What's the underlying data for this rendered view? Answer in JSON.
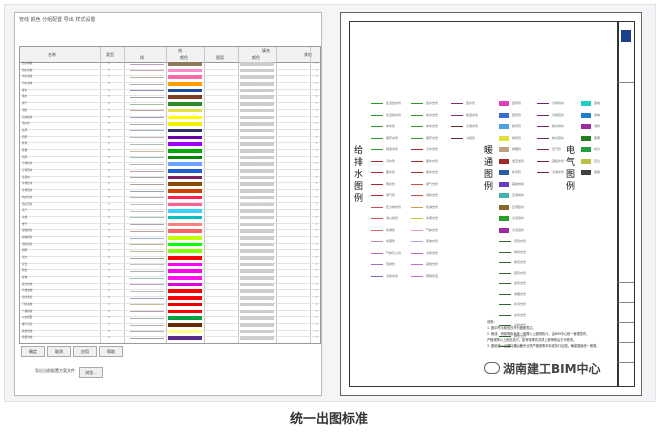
{
  "caption": "统一出图标准",
  "watermark": "湖南建工BIM中心",
  "dialog": {
    "title": "管线 颜色 分组配置 导出 样式设置",
    "headers": {
      "name": "名称",
      "type": "类型",
      "line_group": "线",
      "line_col": "线",
      "color_col": "颜色",
      "fill_group": "填充",
      "pattern_col": "图案",
      "fill_color_col": "颜色",
      "other_col": "其他"
    },
    "rows": [
      {
        "name": "给水系统",
        "num": "3",
        "line": "#b8a0c8",
        "color": "#8c7a5a"
      },
      {
        "name": "热水系统",
        "num": "3",
        "line": "#c8a0c0",
        "color": "#ff88cc"
      },
      {
        "name": "中水系统",
        "num": "3",
        "line": "#c0b0a0",
        "color": "#ff6aa8"
      },
      {
        "name": "污水系统",
        "num": "3",
        "line": "#b0b0b0",
        "color": "#ff9a00"
      },
      {
        "name": "废水",
        "num": "3",
        "line": "#9090c0",
        "color": "#1a4aa0"
      },
      {
        "name": "雨水",
        "num": "3",
        "line": "#a0a0a0",
        "color": "#7f3f1f"
      },
      {
        "name": "通气",
        "num": "3",
        "line": "#a0c0a0",
        "color": "#2a8a2a"
      },
      {
        "name": "消防",
        "num": "3",
        "line": "#c0a0a0",
        "color": "#e0e040"
      },
      {
        "name": "自动喷淋",
        "num": "3",
        "line": "#a0a0c0",
        "color": "#ffff00"
      },
      {
        "name": "消火栓",
        "num": "3",
        "line": "#b0a0b0",
        "color": "#f0f000"
      },
      {
        "name": "送风",
        "num": "3",
        "line": "#a0b0c0",
        "color": "#30306a"
      },
      {
        "name": "回风",
        "num": "3",
        "line": "#c0b0b0",
        "color": "#6a00aa"
      },
      {
        "name": "排风",
        "num": "3",
        "line": "#b0c0b0",
        "color": "#a000ff"
      },
      {
        "name": "排烟",
        "num": "3",
        "line": "#c0c0a0",
        "color": "#00aa00"
      },
      {
        "name": "新风",
        "num": "3",
        "line": "#a0c0c0",
        "color": "#008800"
      },
      {
        "name": "空调供水",
        "num": "3",
        "line": "#b0b0c0",
        "color": "#6aa0ff"
      },
      {
        "name": "空调回水",
        "num": "3",
        "line": "#c0a0b0",
        "color": "#2060d0"
      },
      {
        "name": "冷凝水",
        "num": "3",
        "line": "#a0b0a0",
        "color": "#7a2060"
      },
      {
        "name": "冷却供水",
        "num": "3",
        "line": "#b0a0a0",
        "color": "#8a4a00"
      },
      {
        "name": "冷却回水",
        "num": "3",
        "line": "#a0a0b0",
        "color": "#d04000"
      },
      {
        "name": "热水供水",
        "num": "3",
        "line": "#c0b0c0",
        "color": "#ff2050"
      },
      {
        "name": "热水回水",
        "num": "3",
        "line": "#b0c0c0",
        "color": "#ff6090"
      },
      {
        "name": "蒸汽",
        "num": "3",
        "line": "#c0c0b0",
        "color": "#3ad0ff"
      },
      {
        "name": "冷媒",
        "num": "3",
        "line": "#a0c0b0",
        "color": "#00c0c0"
      },
      {
        "name": "燃气",
        "num": "3",
        "line": "#b0a0c0",
        "color": "#ff8080"
      },
      {
        "name": "强电桥架",
        "num": "3",
        "line": "#c0a0a0",
        "color": "#ff6060"
      },
      {
        "name": "弱电桥架",
        "num": "3",
        "line": "#a0b0c0",
        "color": "#c0ff00"
      },
      {
        "name": "消防桥架",
        "num": "3",
        "line": "#c0b0a0",
        "color": "#00ff00"
      },
      {
        "name": "照明",
        "num": "3",
        "line": "#b0c0a0",
        "color": "#80ff00"
      },
      {
        "name": "动力",
        "num": "3",
        "line": "#a0a0a0",
        "color": "#ff0000"
      },
      {
        "name": "应急",
        "num": "3",
        "line": "#c0c0c0",
        "color": "#ff00ff"
      },
      {
        "name": "防雷",
        "num": "3",
        "line": "#b0b0b0",
        "color": "#ff00ee"
      },
      {
        "name": "接地",
        "num": "3",
        "line": "#a0c0c0",
        "color": "#ff10f0"
      },
      {
        "name": "综合布线",
        "num": "3",
        "line": "#c0a0c0",
        "color": "#e000e0"
      },
      {
        "name": "有线电视",
        "num": "3",
        "line": "#b0c0b0",
        "color": "#ff0000"
      },
      {
        "name": "安防监控",
        "num": "3",
        "line": "#a0a0c0",
        "color": "#ff0000"
      },
      {
        "name": "门禁系统",
        "num": "3",
        "line": "#c0c0a0",
        "color": "#ee0000"
      },
      {
        "name": "广播系统",
        "num": "3",
        "line": "#b0a0b0",
        "color": "#ff0000"
      },
      {
        "name": "火灾报警",
        "num": "3",
        "line": "#a0b0b0",
        "color": "#00a040"
      },
      {
        "name": "楼宇自控",
        "num": "3",
        "line": "#c0b0b0",
        "color": "#6a2a00"
      },
      {
        "name": "其他管线",
        "num": "3",
        "line": "#b0b0a0",
        "color": "#ffff80"
      },
      {
        "name": "预留管线",
        "num": "3",
        "line": "#a0a0a0",
        "color": "#5a2a8a"
      }
    ],
    "buttons": [
      "确定",
      "取消",
      "应用",
      "帮助"
    ],
    "export_label": "导出当前配置方案文件",
    "export_button": "浏览..."
  },
  "sheet": {
    "titles": [
      "给排水图例",
      "暖通图例",
      "电气图例"
    ],
    "legend_cols": [
      {
        "col": "a",
        "items": [
          {
            "c": "#2a9a2a",
            "t": "生活给水管"
          },
          {
            "c": "#2a9a2a",
            "t": "生活热水管"
          },
          {
            "c": "#2a9a2a",
            "t": "中水管"
          },
          {
            "c": "#2a9a2a",
            "t": "循环水管"
          },
          {
            "c": "#2a9a2a",
            "t": "纯净水管"
          },
          {
            "c": "#aa2a2a",
            "t": "污水管"
          },
          {
            "c": "#aa2a2a",
            "t": "废水管"
          },
          {
            "c": "#aa2a2a",
            "t": "雨水管"
          },
          {
            "c": "#aa2a2a",
            "t": "通气管"
          },
          {
            "c": "#cc4a4a",
            "t": "压力排水管"
          },
          {
            "c": "#cc4a4a",
            "t": "消火栓管"
          },
          {
            "c": "#d06a6a",
            "t": "喷淋管"
          },
          {
            "c": "#d08aa0",
            "t": "水幕管"
          },
          {
            "c": "#c06ac0",
            "t": "气体灭火管"
          },
          {
            "c": "#a06ac0",
            "t": "泡沫管"
          },
          {
            "c": "#8a6ac0",
            "t": "冷却水管"
          }
        ]
      },
      {
        "col": "b",
        "items": [
          {
            "c": "#2a9a2a",
            "t": "给水支管"
          },
          {
            "c": "#2a9a2a",
            "t": "热水支管"
          },
          {
            "c": "#2a9a2a",
            "t": "中水支管"
          },
          {
            "c": "#2a9a2a",
            "t": "循环支管"
          },
          {
            "c": "#aa2a2a",
            "t": "污水支管"
          },
          {
            "c": "#aa2a2a",
            "t": "废水支管"
          },
          {
            "c": "#aa2a2a",
            "t": "雨水支管"
          },
          {
            "c": "#cc4a4a",
            "t": "通气支管"
          },
          {
            "c": "#cc4a4a",
            "t": "消防支管"
          },
          {
            "c": "#d0a040",
            "t": "喷淋支管"
          },
          {
            "c": "#d0c040",
            "t": "水幕支管"
          },
          {
            "c": "#e0a0c0",
            "t": "气体支管"
          },
          {
            "c": "#c0a0e0",
            "t": "泡沫支管"
          },
          {
            "c": "#c06ac0",
            "t": "冷却支管"
          },
          {
            "c": "#d06ad0",
            "t": "其他支管"
          },
          {
            "c": "#d06ad0",
            "t": "预留管道"
          }
        ]
      },
      {
        "col": "c",
        "items": [
          {
            "c": "#8a2a6a",
            "t": "回水管"
          },
          {
            "c": "#8a2a6a",
            "t": "热回水管"
          },
          {
            "c": "#6a2a2a",
            "t": "冷凝水管"
          },
          {
            "c": "#6a2a2a",
            "t": "冷媒管"
          }
        ]
      }
    ],
    "hvac_items": [
      {
        "c": "#e040c0",
        "t": "送风管"
      },
      {
        "c": "#3a6ad0",
        "t": "回风管"
      },
      {
        "c": "#4aa0e0",
        "t": "新风管"
      },
      {
        "c": "#e0e040",
        "t": "排风管"
      },
      {
        "c": "#c0a080",
        "t": "排烟管"
      },
      {
        "c": "#a02a2a",
        "t": "加压送风"
      },
      {
        "c": "#2a5aa0",
        "t": "补风管"
      },
      {
        "c": "#6a40c0",
        "t": "事故排风"
      },
      {
        "c": "#40b0b0",
        "t": "空调供水"
      },
      {
        "c": "#8a6a2a",
        "t": "空调回水"
      },
      {
        "c": "#2aa02a",
        "t": "冷冻供水"
      },
      {
        "c": "#a02aa0",
        "t": "冷冻回水"
      }
    ],
    "hvac_line_items": [
      {
        "c": "#6a2a6a",
        "t": "冷却供水"
      },
      {
        "c": "#6a2a6a",
        "t": "冷却回水"
      },
      {
        "c": "#6a2a6a",
        "t": "热水供水"
      },
      {
        "c": "#6a2a6a",
        "t": "热水回水"
      },
      {
        "c": "#8a2a2a",
        "t": "蒸汽管"
      },
      {
        "c": "#6a2a2a",
        "t": "凝结水管"
      },
      {
        "c": "#6a2a2a",
        "t": "冷凝水管"
      }
    ],
    "hvac_lines2": [
      {
        "c": "#2a6a2a",
        "t": "风管支管"
      },
      {
        "c": "#2a6a2a",
        "t": "排风支管"
      },
      {
        "c": "#2a6a2a",
        "t": "新风支管"
      },
      {
        "c": "#2a6a2a",
        "t": "回风支管"
      },
      {
        "c": "#2a6a2a",
        "t": "送风支管"
      },
      {
        "c": "#2a6a2a",
        "t": "排烟支管"
      },
      {
        "c": "#2a6a2a",
        "t": "补风支管"
      },
      {
        "c": "#2a6a2a",
        "t": "水管支管"
      },
      {
        "c": "#2a6a2a",
        "t": "冷媒支管"
      },
      {
        "c": "#2a6a2a",
        "t": "其他支管"
      },
      {
        "c": "#2a6a2a",
        "t": "预留管"
      }
    ],
    "elec_items": [
      {
        "c": "#20d0c0",
        "t": "强电"
      },
      {
        "c": "#2080d0",
        "t": "弱电"
      },
      {
        "c": "#a02aa0",
        "t": "消防"
      },
      {
        "c": "#208020",
        "t": "照明"
      },
      {
        "c": "#20a040",
        "t": "动力"
      },
      {
        "c": "#c0c040",
        "t": "应急"
      },
      {
        "c": "#404040",
        "t": "其他"
      }
    ],
    "notes": [
      "说明：",
      "1. 图中所示颜色仅作为图面表达。",
      "2. 管线、桥架等颜色统一按照以上图例执行，由BIM中心统一管理发布。",
      "   严格按照以上颜色执行，如有特殊情况须上报审核后方可修改。",
      "3. 图纸统一出图标准，各专业须严格按照本标准执行出图，确保图面统一美观。"
    ]
  }
}
